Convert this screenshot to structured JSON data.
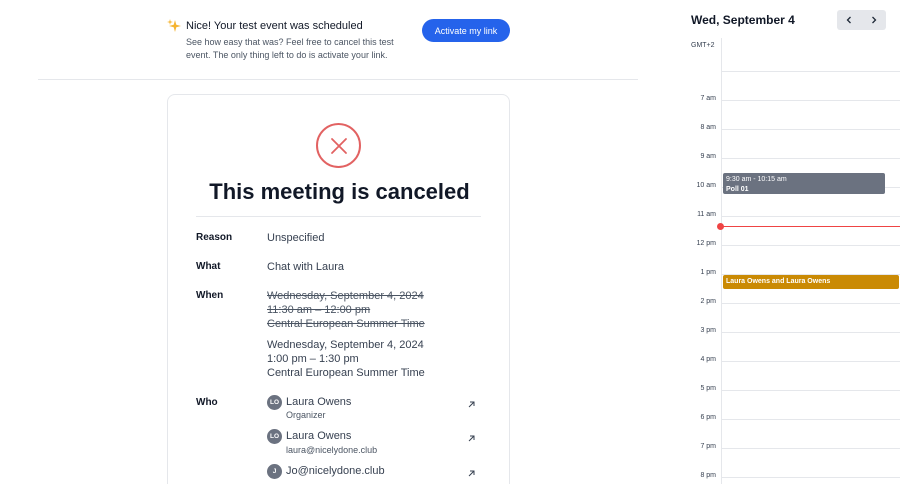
{
  "banner": {
    "title": "Nice! Your test event was scheduled",
    "description": "See how easy that was? Feel free to cancel this test event. The only thing left to do is activate your link.",
    "button_label": "Activate my link",
    "sparkle_icon": "sparkle-icon",
    "colors": {
      "sparkle": "#f5b431",
      "button": "#2563eb"
    }
  },
  "booking": {
    "status_icon": "x-circle-icon",
    "title": "This meeting is canceled",
    "reason_label": "Reason",
    "reason_value": "Unspecified",
    "what_label": "What",
    "what_value": "Chat with Laura",
    "when_label": "When",
    "old_date": "Wednesday, September 4, 2024",
    "old_time": "11:30 am – 12:00 pm",
    "old_tz": "Central European Summer Time",
    "new_date": "Wednesday, September 4, 2024",
    "new_time": "1:00 pm – 1:30 pm",
    "new_tz": "Central European Summer Time",
    "who_label": "Who",
    "attendees": [
      {
        "initials": "LO",
        "name": "Laura Owens",
        "sub": "Organizer"
      },
      {
        "initials": "LO",
        "name": "Laura Owens",
        "sub": "laura@nicelydone.club"
      },
      {
        "initials": "J",
        "name": "Jo@nicelydone.club",
        "sub": ""
      }
    ],
    "colors": {
      "cancel": "#e26262"
    }
  },
  "calendar": {
    "date_title": "Wed, September 4",
    "timezone": "GMT+2",
    "hours": [
      "7 am",
      "8 am",
      "9 am",
      "10 am",
      "11 am",
      "12 pm",
      "1 pm",
      "2 pm",
      "3 pm",
      "4 pm",
      "5 pm",
      "6 pm",
      "7 pm",
      "8 pm"
    ],
    "events": [
      {
        "time": "9:30 am - 10:15 am",
        "title": "Poll 01",
        "color": "#6b7280"
      },
      {
        "title": "Laura Owens and Laura Owens",
        "color": "#ca8a04"
      }
    ],
    "now_color": "#ef4444"
  }
}
